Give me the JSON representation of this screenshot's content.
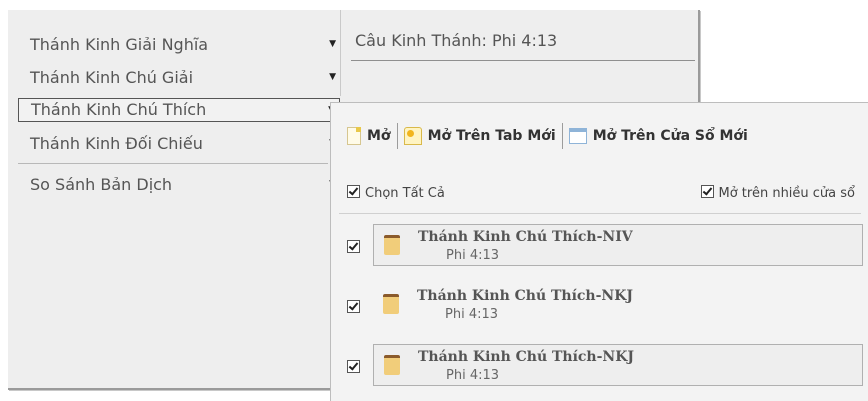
{
  "left_menu": {
    "items": [
      {
        "label": "Thánh Kinh Giải Nghĩa"
      },
      {
        "label": "Thánh Kinh Chú Giải"
      },
      {
        "label": "Thánh Kinh Chú Thích"
      },
      {
        "label": "Thánh Kinh Đối Chiếu"
      }
    ],
    "compare": {
      "label": "So Sánh Bản Dịch"
    },
    "caret": "▼"
  },
  "header": {
    "verse_title": "Câu Kinh Thánh: Phi 4:13"
  },
  "popup": {
    "toolbar": {
      "open_label": "Mở",
      "open_new_tab_label": "Mở Trên Tab Mới",
      "open_new_window_label": "Mở Trên Cửa Sổ Mới"
    },
    "select_all_label": "Chọn Tất Cả",
    "multi_window_label": "Mở trên nhiều cửa sổ",
    "entries": [
      {
        "title": "Thánh Kinh Chú Thích-NIV",
        "ref": "Phi 4:13"
      },
      {
        "title": "Thánh Kinh Chú Thích-NKJ",
        "ref": "Phi 4:13"
      },
      {
        "title": "Thánh Kinh Chú Thích-NKJ",
        "ref": "Phi 4:13"
      }
    ]
  },
  "colors": {
    "panel_bg": "#eeeeee",
    "popup_bg": "#f3f3f3",
    "book_icon": "#f1cd7a"
  },
  "icons": [
    "caret-down-icon",
    "document-icon",
    "new-tab-icon",
    "new-window-icon",
    "checkbox-icon",
    "book-icon"
  ]
}
